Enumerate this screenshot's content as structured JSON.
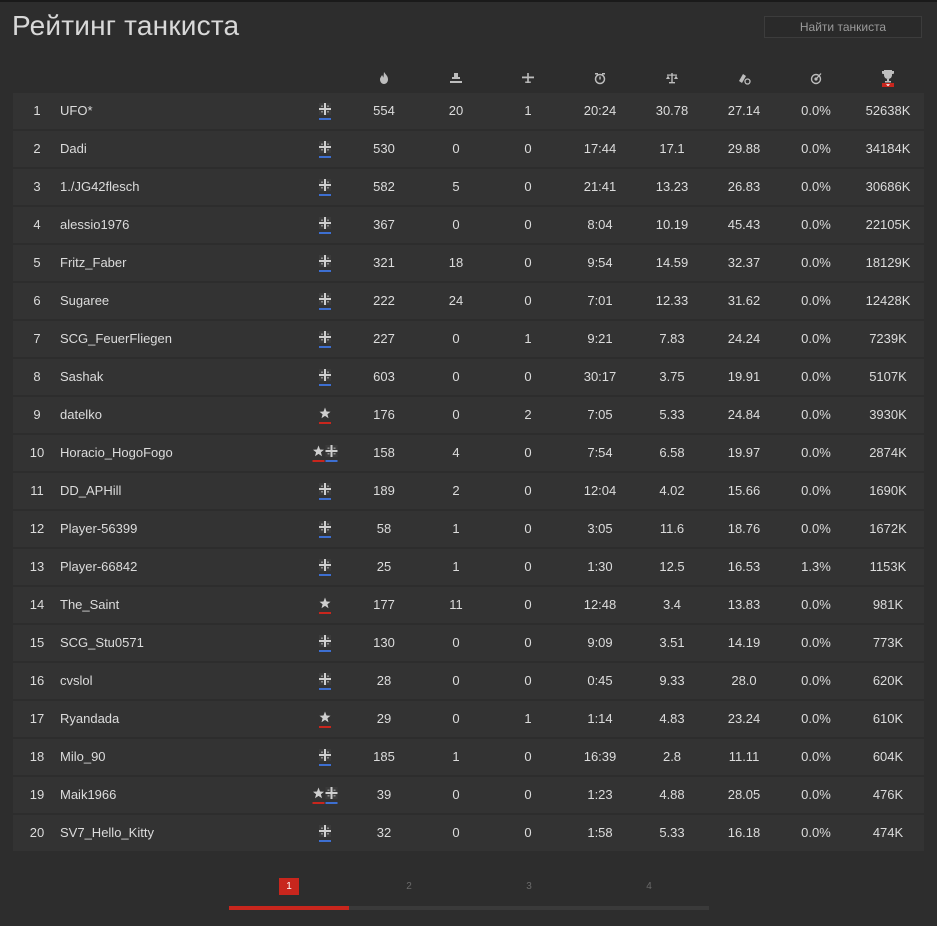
{
  "page": {
    "title": "Рейтинг танкиста"
  },
  "search": {
    "placeholder": "Найти танкиста"
  },
  "colors": {
    "accent": "#c8261d",
    "allied_blue": "#3d6fd1",
    "axis_red": "#c8261d",
    "row_bg": "#333333",
    "page_bg": "#2d2d2d"
  },
  "columns": [
    {
      "key": "kills",
      "icon": "flame-icon"
    },
    {
      "key": "ground_kills",
      "icon": "ground-target-icon"
    },
    {
      "key": "air_kills",
      "icon": "plane-icon"
    },
    {
      "key": "flight_time",
      "icon": "clock-icon"
    },
    {
      "key": "kd",
      "icon": "scales-icon"
    },
    {
      "key": "accuracy",
      "icon": "shells-icon"
    },
    {
      "key": "hit_rate",
      "icon": "target-icon"
    },
    {
      "key": "score",
      "icon": "trophy-icon"
    }
  ],
  "rows": [
    {
      "rank": "1",
      "name": "UFO*",
      "badges": [
        "cross"
      ],
      "kills": "554",
      "ground": "20",
      "air": "1",
      "time": "20:24",
      "kd": "30.78",
      "acc": "27.14",
      "hit": "0.0%",
      "score": "52638K"
    },
    {
      "rank": "2",
      "name": "Dadi",
      "badges": [
        "cross"
      ],
      "kills": "530",
      "ground": "0",
      "air": "0",
      "time": "17:44",
      "kd": "17.1",
      "acc": "29.88",
      "hit": "0.0%",
      "score": "34184K"
    },
    {
      "rank": "3",
      "name": "1./JG42flesch",
      "badges": [
        "cross"
      ],
      "kills": "582",
      "ground": "5",
      "air": "0",
      "time": "21:41",
      "kd": "13.23",
      "acc": "26.83",
      "hit": "0.0%",
      "score": "30686K"
    },
    {
      "rank": "4",
      "name": "alessio1976",
      "badges": [
        "cross"
      ],
      "kills": "367",
      "ground": "0",
      "air": "0",
      "time": "8:04",
      "kd": "10.19",
      "acc": "45.43",
      "hit": "0.0%",
      "score": "22105K"
    },
    {
      "rank": "5",
      "name": "Fritz_Faber",
      "badges": [
        "cross"
      ],
      "kills": "321",
      "ground": "18",
      "air": "0",
      "time": "9:54",
      "kd": "14.59",
      "acc": "32.37",
      "hit": "0.0%",
      "score": "18129K"
    },
    {
      "rank": "6",
      "name": "Sugaree",
      "badges": [
        "cross"
      ],
      "kills": "222",
      "ground": "24",
      "air": "0",
      "time": "7:01",
      "kd": "12.33",
      "acc": "31.62",
      "hit": "0.0%",
      "score": "12428K"
    },
    {
      "rank": "7",
      "name": "SCG_FeuerFliegen",
      "badges": [
        "cross"
      ],
      "kills": "227",
      "ground": "0",
      "air": "1",
      "time": "9:21",
      "kd": "7.83",
      "acc": "24.24",
      "hit": "0.0%",
      "score": "7239K"
    },
    {
      "rank": "8",
      "name": "Sashak",
      "badges": [
        "cross"
      ],
      "kills": "603",
      "ground": "0",
      "air": "0",
      "time": "30:17",
      "kd": "3.75",
      "acc": "19.91",
      "hit": "0.0%",
      "score": "5107K"
    },
    {
      "rank": "9",
      "name": "datelko",
      "badges": [
        "star"
      ],
      "kills": "176",
      "ground": "0",
      "air": "2",
      "time": "7:05",
      "kd": "5.33",
      "acc": "24.84",
      "hit": "0.0%",
      "score": "3930K"
    },
    {
      "rank": "10",
      "name": "Horacio_HogoFogo",
      "badges": [
        "star",
        "cross"
      ],
      "kills": "158",
      "ground": "4",
      "air": "0",
      "time": "7:54",
      "kd": "6.58",
      "acc": "19.97",
      "hit": "0.0%",
      "score": "2874K"
    },
    {
      "rank": "11",
      "name": "DD_APHill",
      "badges": [
        "cross"
      ],
      "kills": "189",
      "ground": "2",
      "air": "0",
      "time": "12:04",
      "kd": "4.02",
      "acc": "15.66",
      "hit": "0.0%",
      "score": "1690K"
    },
    {
      "rank": "12",
      "name": "Player-56399",
      "badges": [
        "cross"
      ],
      "kills": "58",
      "ground": "1",
      "air": "0",
      "time": "3:05",
      "kd": "11.6",
      "acc": "18.76",
      "hit": "0.0%",
      "score": "1672K"
    },
    {
      "rank": "13",
      "name": "Player-66842",
      "badges": [
        "cross"
      ],
      "kills": "25",
      "ground": "1",
      "air": "0",
      "time": "1:30",
      "kd": "12.5",
      "acc": "16.53",
      "hit": "1.3%",
      "score": "1153K"
    },
    {
      "rank": "14",
      "name": "The_Saint",
      "badges": [
        "star"
      ],
      "kills": "177",
      "ground": "11",
      "air": "0",
      "time": "12:48",
      "kd": "3.4",
      "acc": "13.83",
      "hit": "0.0%",
      "score": "981K"
    },
    {
      "rank": "15",
      "name": "SCG_Stu0571",
      "badges": [
        "cross"
      ],
      "kills": "130",
      "ground": "0",
      "air": "0",
      "time": "9:09",
      "kd": "3.51",
      "acc": "14.19",
      "hit": "0.0%",
      "score": "773K"
    },
    {
      "rank": "16",
      "name": "cvslol",
      "badges": [
        "cross"
      ],
      "kills": "28",
      "ground": "0",
      "air": "0",
      "time": "0:45",
      "kd": "9.33",
      "acc": "28.0",
      "hit": "0.0%",
      "score": "620K"
    },
    {
      "rank": "17",
      "name": "Ryandada",
      "badges": [
        "star"
      ],
      "kills": "29",
      "ground": "0",
      "air": "1",
      "time": "1:14",
      "kd": "4.83",
      "acc": "23.24",
      "hit": "0.0%",
      "score": "610K"
    },
    {
      "rank": "18",
      "name": "Milo_90",
      "badges": [
        "cross"
      ],
      "kills": "185",
      "ground": "1",
      "air": "0",
      "time": "16:39",
      "kd": "2.8",
      "acc": "11.11",
      "hit": "0.0%",
      "score": "604K"
    },
    {
      "rank": "19",
      "name": "Maik1966",
      "badges": [
        "star",
        "cross"
      ],
      "kills": "39",
      "ground": "0",
      "air": "0",
      "time": "1:23",
      "kd": "4.88",
      "acc": "28.05",
      "hit": "0.0%",
      "score": "476K"
    },
    {
      "rank": "20",
      "name": "SV7_Hello_Kitty",
      "badges": [
        "cross"
      ],
      "kills": "32",
      "ground": "0",
      "air": "0",
      "time": "1:58",
      "kd": "5.33",
      "acc": "16.18",
      "hit": "0.0%",
      "score": "474K"
    }
  ],
  "pagination": {
    "pages": [
      "1",
      "2",
      "3",
      "4"
    ],
    "current": "1",
    "progress_fraction": 0.25
  }
}
